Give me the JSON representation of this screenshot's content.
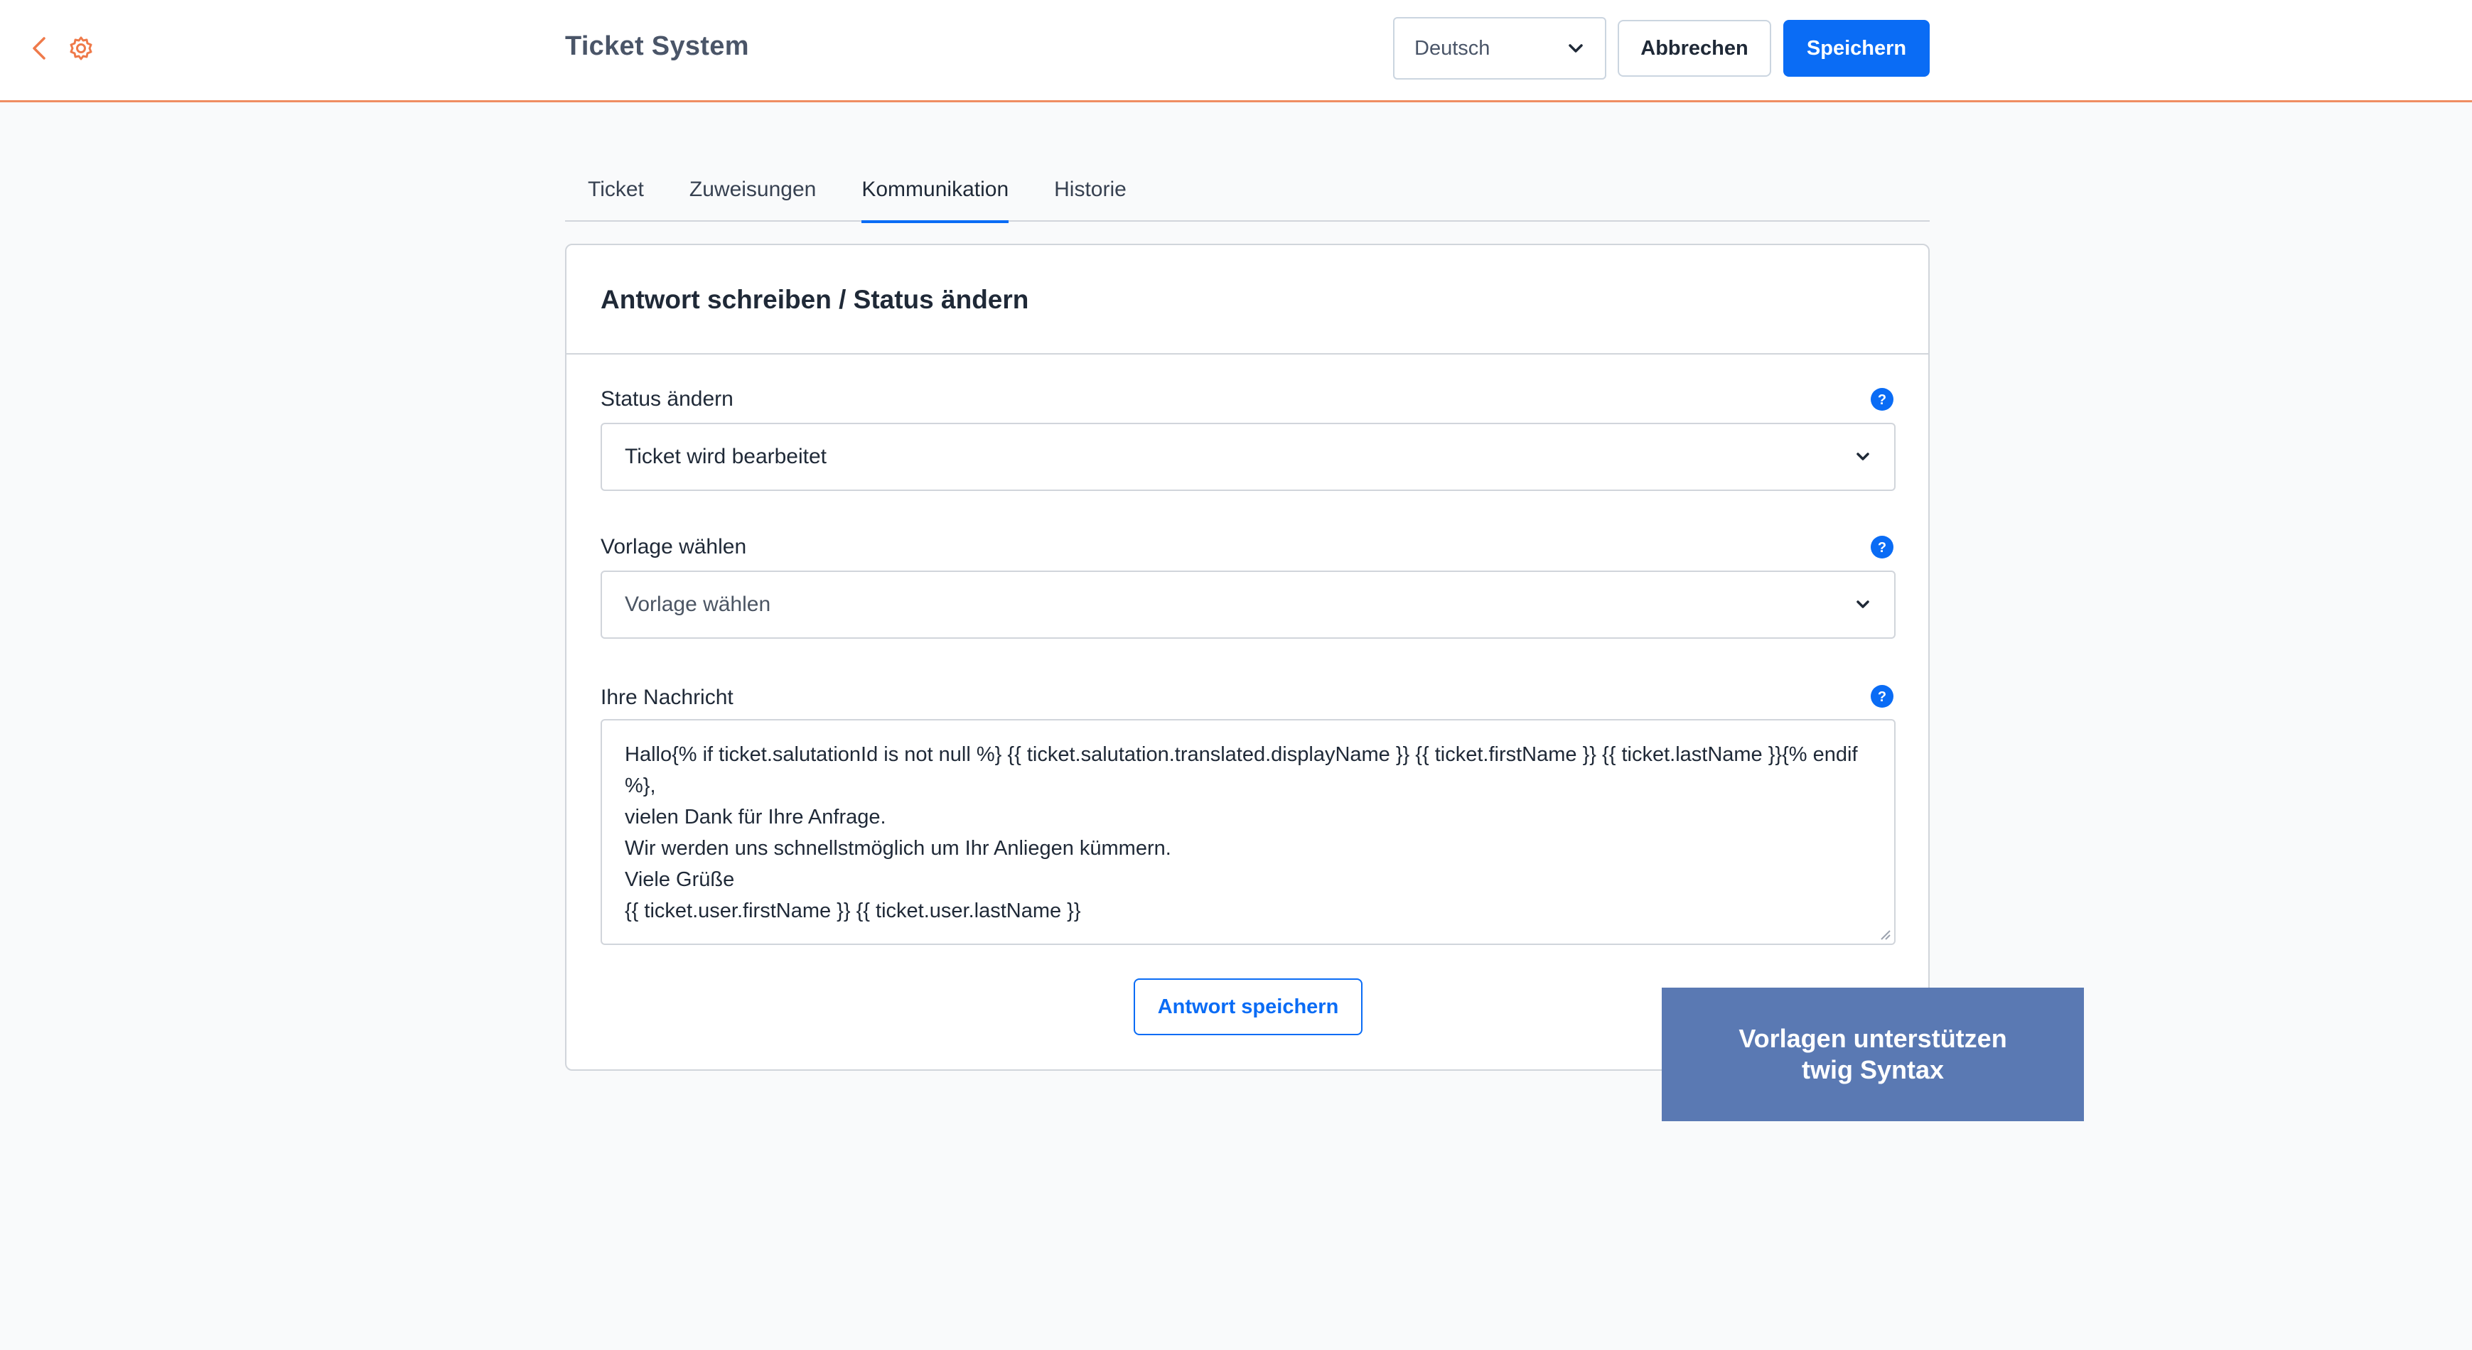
{
  "header": {
    "title": "Ticket System",
    "language": "Deutsch",
    "cancel_label": "Abbrechen",
    "save_label": "Speichern"
  },
  "tabs": [
    {
      "label": "Ticket"
    },
    {
      "label": "Zuweisungen"
    },
    {
      "label": "Kommunikation",
      "active": true
    },
    {
      "label": "Historie"
    }
  ],
  "card": {
    "title": "Antwort schreiben / Status ändern",
    "status": {
      "label": "Status ändern",
      "value": "Ticket wird bearbeitet"
    },
    "template": {
      "label": "Vorlage wählen",
      "placeholder": "Vorlage wählen"
    },
    "message": {
      "label": "Ihre Nachricht",
      "lines": [
        "Hallo{% if ticket.salutationId is not null %} {{ ticket.salutation.translated.displayName }} {{ ticket.firstName }} {{ ticket.lastName }}{% endif %},",
        "vielen Dank für Ihre Anfrage.",
        "Wir werden uns schnellstmöglich um Ihr Anliegen kümmern.",
        "Viele Grüße",
        "{{ ticket.user.firstName }} {{ ticket.user.lastName }}"
      ]
    },
    "submit_label": "Antwort speichern"
  },
  "callout": {
    "line1": "Vorlagen unterstützen",
    "line2": "twig Syntax"
  },
  "colors": {
    "accent": "#0a6cf5",
    "topbar_border": "#ef8d62",
    "callout_bg": "#5a79b3"
  }
}
